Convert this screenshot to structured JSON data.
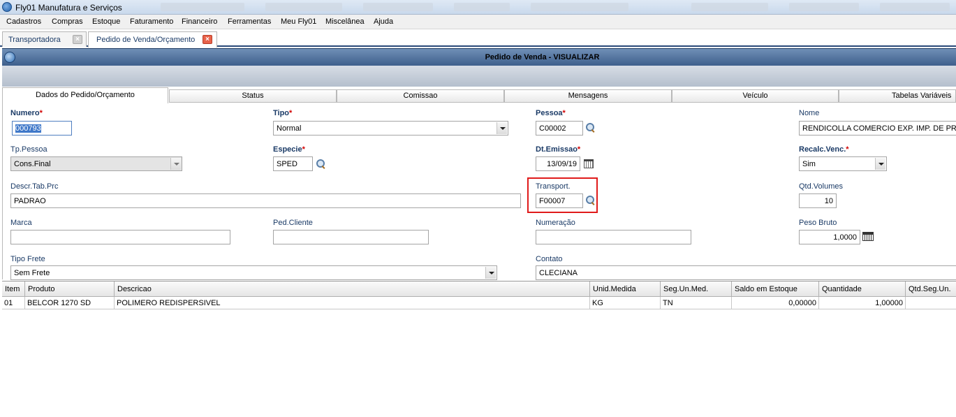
{
  "window": {
    "title": "Fly01 Manufatura e Serviços"
  },
  "menu": [
    {
      "label": "Cadastros"
    },
    {
      "label": "Compras"
    },
    {
      "label": "Estoque"
    },
    {
      "label": "Faturamento"
    },
    {
      "label": "Financeiro"
    },
    {
      "label": "Ferramentas"
    },
    {
      "label": "Meu Fly01"
    },
    {
      "label": "Miscelânea"
    },
    {
      "label": "Ajuda"
    }
  ],
  "doc_tabs": [
    {
      "label": "Transportadora",
      "active": false,
      "close_icon": "close-icon"
    },
    {
      "label": "Pedido de Venda/Orçamento",
      "active": true,
      "close_icon": "close-icon"
    }
  ],
  "panel": {
    "title": "Pedido de Venda - VISUALIZAR"
  },
  "sub_tabs": [
    {
      "label": "Dados do Pedido/Orçamento",
      "active": true
    },
    {
      "label": "Status"
    },
    {
      "label": "Comissao"
    },
    {
      "label": "Mensagens"
    },
    {
      "label": "Veículo"
    },
    {
      "label": "Tabelas Variáveis"
    }
  ],
  "form": {
    "numero": {
      "label": "Numero",
      "value": "000793"
    },
    "tipo": {
      "label": "Tipo",
      "value": "Normal"
    },
    "pessoa": {
      "label": "Pessoa",
      "value": "C00002"
    },
    "nome": {
      "label": "Nome",
      "value": "RENDICOLLA COMERCIO EXP. IMP. DE PRODUTOS"
    },
    "tp_pessoa": {
      "label": "Tp.Pessoa",
      "value": "Cons.Final"
    },
    "especie": {
      "label": "Especie",
      "value": "SPED"
    },
    "dt_emissao": {
      "label": "Dt.Emissao",
      "value": "13/09/19"
    },
    "recalc_venc": {
      "label": "Recalc.Venc.",
      "value": "Sim"
    },
    "descr_tab_prc": {
      "label": "Descr.Tab.Prc",
      "value": "PADRAO"
    },
    "transport": {
      "label": "Transport.",
      "value": "F00007"
    },
    "qtd_volumes": {
      "label": "Qtd.Volumes",
      "value": "10"
    },
    "marca": {
      "label": "Marca",
      "value": ""
    },
    "ped_cliente": {
      "label": "Ped.Cliente",
      "value": ""
    },
    "numeracao": {
      "label": "Numeração",
      "value": ""
    },
    "peso_bruto": {
      "label": "Peso Bruto",
      "value": "1,0000"
    },
    "tipo_frete": {
      "label": "Tipo Frete",
      "value": "Sem Frete"
    },
    "contato": {
      "label": "Contato",
      "value": "CLECIANA"
    },
    "required_marker": "*"
  },
  "grid": {
    "columns": [
      "Item",
      "Produto",
      "Descricao",
      "Unid.Medida",
      "Seg.Un.Med.",
      "Saldo em Estoque",
      "Quantidade",
      "Qtd.Seg.Un."
    ],
    "rows": [
      [
        "01",
        "BELCOR 1270 SD",
        "POLIMERO REDISPERSIVEL",
        "KG",
        "TN",
        "0,00000",
        "1,00000",
        ""
      ]
    ]
  },
  "colors": {
    "label": "#1a3a66",
    "required": "#d10000",
    "highlight_box": "#e01b1b",
    "panel_header": "#3e5f8c"
  }
}
